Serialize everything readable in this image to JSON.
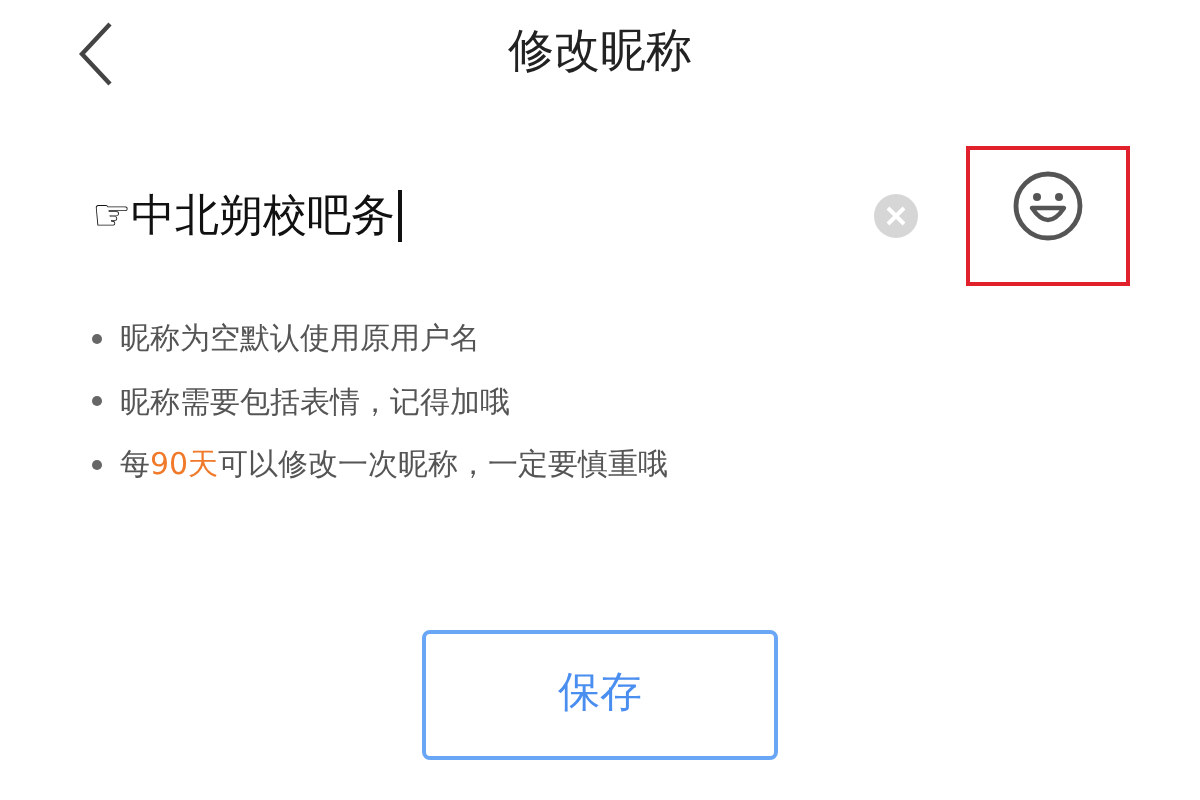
{
  "header": {
    "title": "修改昵称"
  },
  "nickname_field": {
    "value": "☞中北朔校吧务",
    "emoji_button": {
      "highlighted": true
    }
  },
  "tips": [
    [
      {
        "text": "昵称为空默认使用原用户名",
        "highlight": false
      }
    ],
    [
      {
        "text": "昵称需要包括表情，记得加哦",
        "highlight": false
      }
    ],
    [
      {
        "text": "每",
        "highlight": false
      },
      {
        "text": "90天",
        "highlight": true
      },
      {
        "text": "可以修改一次昵称，一定要慎重哦",
        "highlight": false
      }
    ]
  ],
  "save_button": {
    "label": "保存"
  }
}
